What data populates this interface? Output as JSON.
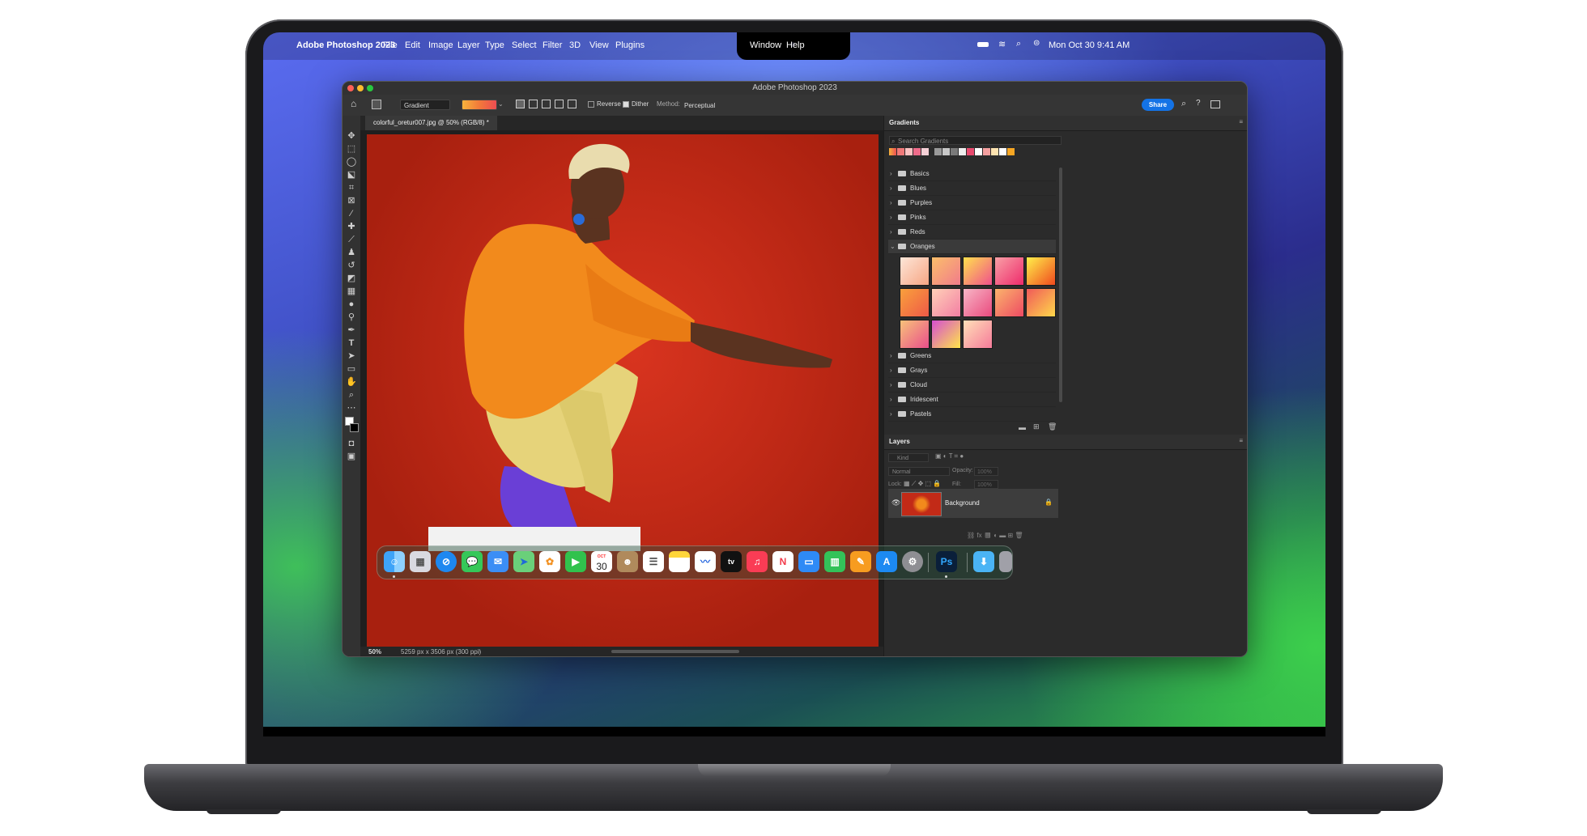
{
  "menubar": {
    "apple": "",
    "app_name": "Adobe Photoshop 2023",
    "menus": [
      "File",
      "Edit",
      "Image",
      "Layer",
      "Type",
      "Select",
      "Filter",
      "3D",
      "View",
      "Plugins"
    ],
    "menus_right": [
      "Window",
      "Help"
    ],
    "clock": "Mon Oct 30  9:41 AM"
  },
  "ps": {
    "window_title": "Adobe Photoshop 2023",
    "options": {
      "tool_preset": "Gradient",
      "reverse_label": "Reverse",
      "dither_label": "Dither",
      "method_label": "Method:",
      "method_value": "Perceptual",
      "share_label": "Share"
    },
    "document_tab": "colorful_oretur007.jpg @ 50% (RGB/8) *",
    "status": {
      "zoom": "50%",
      "doc_info": "5259 px x 3506 px (300 ppi)"
    },
    "gradients_panel": {
      "title": "Gradients",
      "search_placeholder": "Search Gradients",
      "folders_before": [
        "Basics",
        "Blues",
        "Purples",
        "Pinks",
        "Reds"
      ],
      "open_folder": "Oranges",
      "folders_after": [
        "Greens",
        "Grays",
        "Cloud",
        "Iridescent",
        "Pastels"
      ]
    },
    "layers_panel": {
      "title": "Layers",
      "filter_kind": "Kind",
      "blend_mode": "Normal",
      "opacity_label": "Opacity:",
      "opacity_value": "100%",
      "lock_label": "Lock:",
      "fill_label": "Fill:",
      "fill_value": "100%",
      "layer_name": "Background"
    }
  },
  "dock": {
    "calendar_month": "OCT",
    "calendar_day": "30",
    "tv_label": "tv",
    "ps_label": "Ps"
  },
  "colors": {
    "accent": "#1473e6",
    "canvas_red": "#c22a17",
    "sweater_orange": "#f28a1c",
    "pants_yellow": "#e9d77a"
  }
}
